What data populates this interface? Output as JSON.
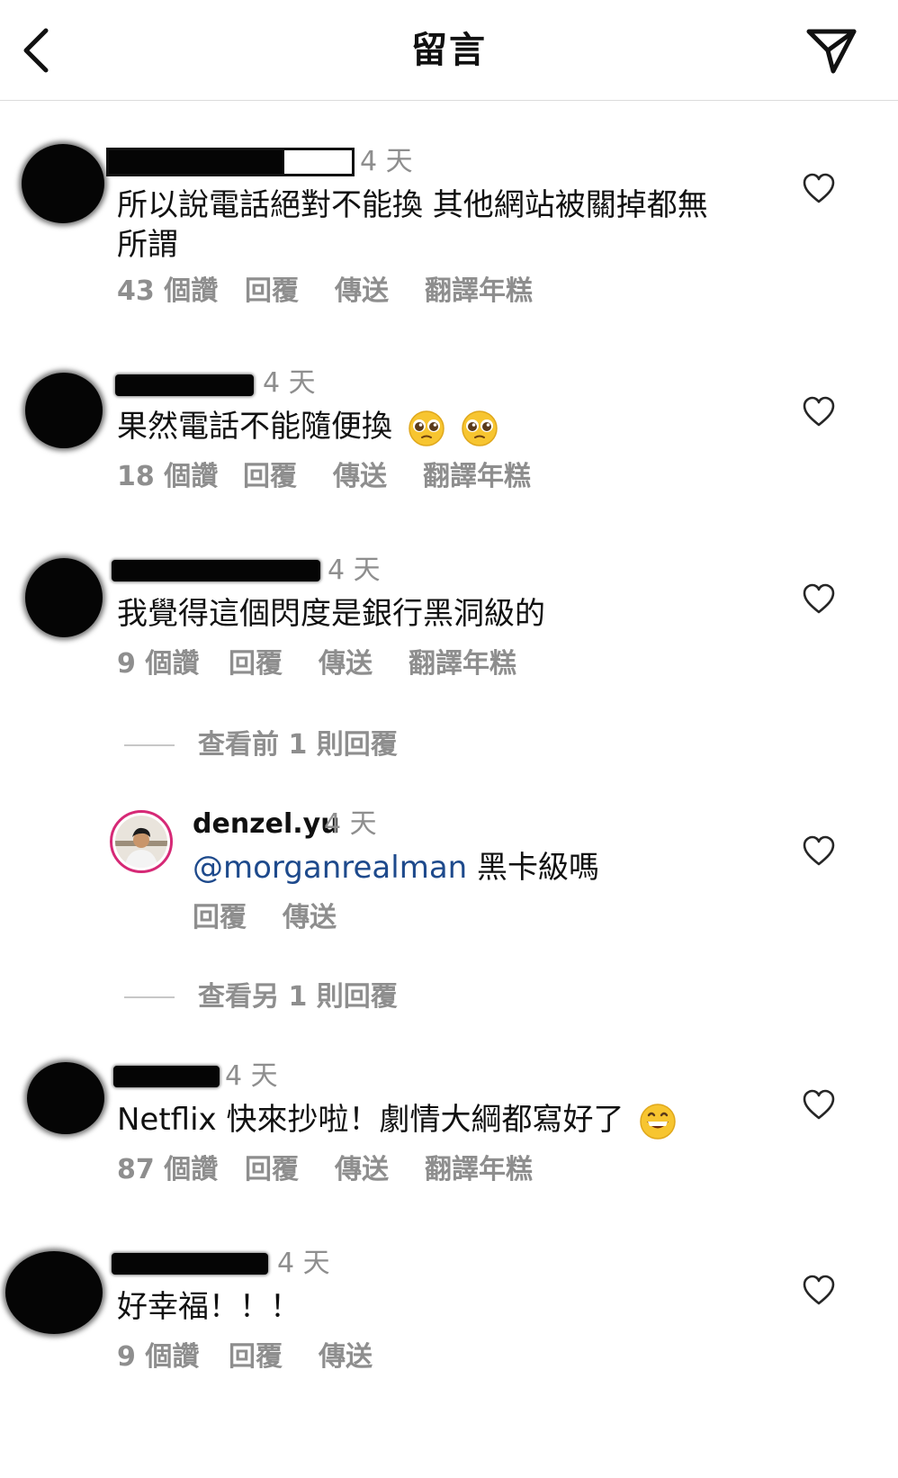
{
  "header": {
    "title": "留言"
  },
  "comments": [
    {
      "time": "4 天",
      "text": "所以說電話絕對不能換 其他網站被關掉都無所謂",
      "likes": "43 個讚",
      "reply": "回覆",
      "send": "傳送",
      "translate": "翻譯年糕"
    },
    {
      "time": "4 天",
      "text": "果然電話不能隨便換",
      "likes": "18 個讚",
      "reply": "回覆",
      "send": "傳送",
      "translate": "翻譯年糕"
    },
    {
      "time": "4 天",
      "text": "我覺得這個閃度是銀行黑洞級的",
      "likes": "9 個讚",
      "reply": "回覆",
      "send": "傳送",
      "translate": "翻譯年糕"
    },
    {
      "time": "4 天",
      "text": "Netflix 快來抄啦！劇情大綱都寫好了",
      "likes": "87 個讚",
      "reply": "回覆",
      "send": "傳送",
      "translate": "翻譯年糕"
    },
    {
      "time": "4 天",
      "text": "好幸福！！！",
      "likes": "9 個讚",
      "reply": "回覆",
      "send": "傳送"
    }
  ],
  "view_previous": "查看前 1 則回覆",
  "view_other": "查看另 1 則回覆",
  "reply": {
    "username": "denzel.yu",
    "time": "4 天",
    "mention": "@morganrealman",
    "text": " 黑卡級嗎",
    "reply": "回覆",
    "send": "傳送"
  },
  "colors": {
    "muted": "#8e8e8e",
    "mention": "#1e4a8c",
    "avatar_ring": "#d62976"
  },
  "icons": [
    "back-arrow-icon",
    "paper-plane-icon",
    "heart-icon",
    "pleading-face-emoji",
    "grinning-face-emoji"
  ]
}
